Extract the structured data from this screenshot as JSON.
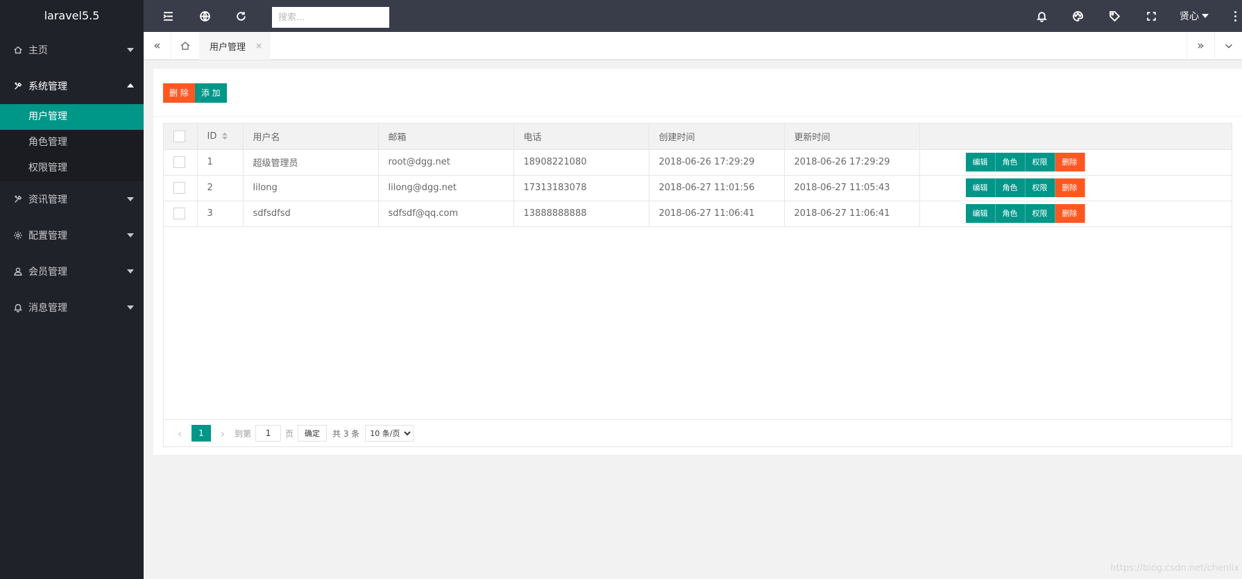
{
  "app": {
    "logo": "laravel5.5"
  },
  "header": {
    "search_placeholder": "搜索...",
    "user_name": "贤心",
    "icons": [
      "menu-fold-icon",
      "globe-icon",
      "refresh-icon",
      "bell-icon",
      "theme-icon",
      "tag-icon",
      "fullscreen-icon",
      "more-icon"
    ]
  },
  "sidebar": {
    "items": [
      {
        "label": "主页",
        "icon": "home-icon"
      },
      {
        "label": "系统管理",
        "icon": "tools-icon",
        "open": true,
        "children": [
          {
            "label": "用户管理",
            "active": true
          },
          {
            "label": "角色管理"
          },
          {
            "label": "权限管理"
          }
        ]
      },
      {
        "label": "资讯管理",
        "icon": "tools-icon"
      },
      {
        "label": "配置管理",
        "icon": "gear-icon"
      },
      {
        "label": "会员管理",
        "icon": "user-icon"
      },
      {
        "label": "消息管理",
        "icon": "bell-icon"
      }
    ]
  },
  "tabs": {
    "active": "用户管理",
    "close": "×",
    "left_nav": "«",
    "right_nav": "»"
  },
  "toolbar": {
    "delete_label": "删 除",
    "add_label": "添 加"
  },
  "table": {
    "columns": [
      "ID",
      "用户名",
      "邮箱",
      "电话",
      "创建时间",
      "更新时间",
      ""
    ],
    "rows": [
      {
        "id": "1",
        "username": "超级管理员",
        "email": "root@dgg.net",
        "phone": "18908221080",
        "created": "2018-06-26 17:29:29",
        "updated": "2018-06-26 17:29:29"
      },
      {
        "id": "2",
        "username": "lilong",
        "email": "lilong@dgg.net",
        "phone": "17313183078",
        "created": "2018-06-27 11:01:56",
        "updated": "2018-06-27 11:05:43"
      },
      {
        "id": "3",
        "username": "sdfsdfsd",
        "email": "sdfsdf@qq.com",
        "phone": "13888888888",
        "created": "2018-06-27 11:06:41",
        "updated": "2018-06-27 11:06:41"
      }
    ],
    "row_actions": {
      "edit": "编辑",
      "role": "角色",
      "perm": "权限",
      "delete": "删除"
    }
  },
  "pagination": {
    "prev": "‹",
    "next": "›",
    "current": "1",
    "goto_label": "到第",
    "goto_value": "1",
    "page_label": "页",
    "confirm": "确定",
    "total": "共 3 条",
    "per_page": "10 条/页"
  },
  "watermark": "https://blog.csdn.net/chenlix",
  "colors": {
    "primary": "#009688",
    "danger": "#FF5722",
    "header": "#393D49",
    "sidebar": "#20222A"
  }
}
